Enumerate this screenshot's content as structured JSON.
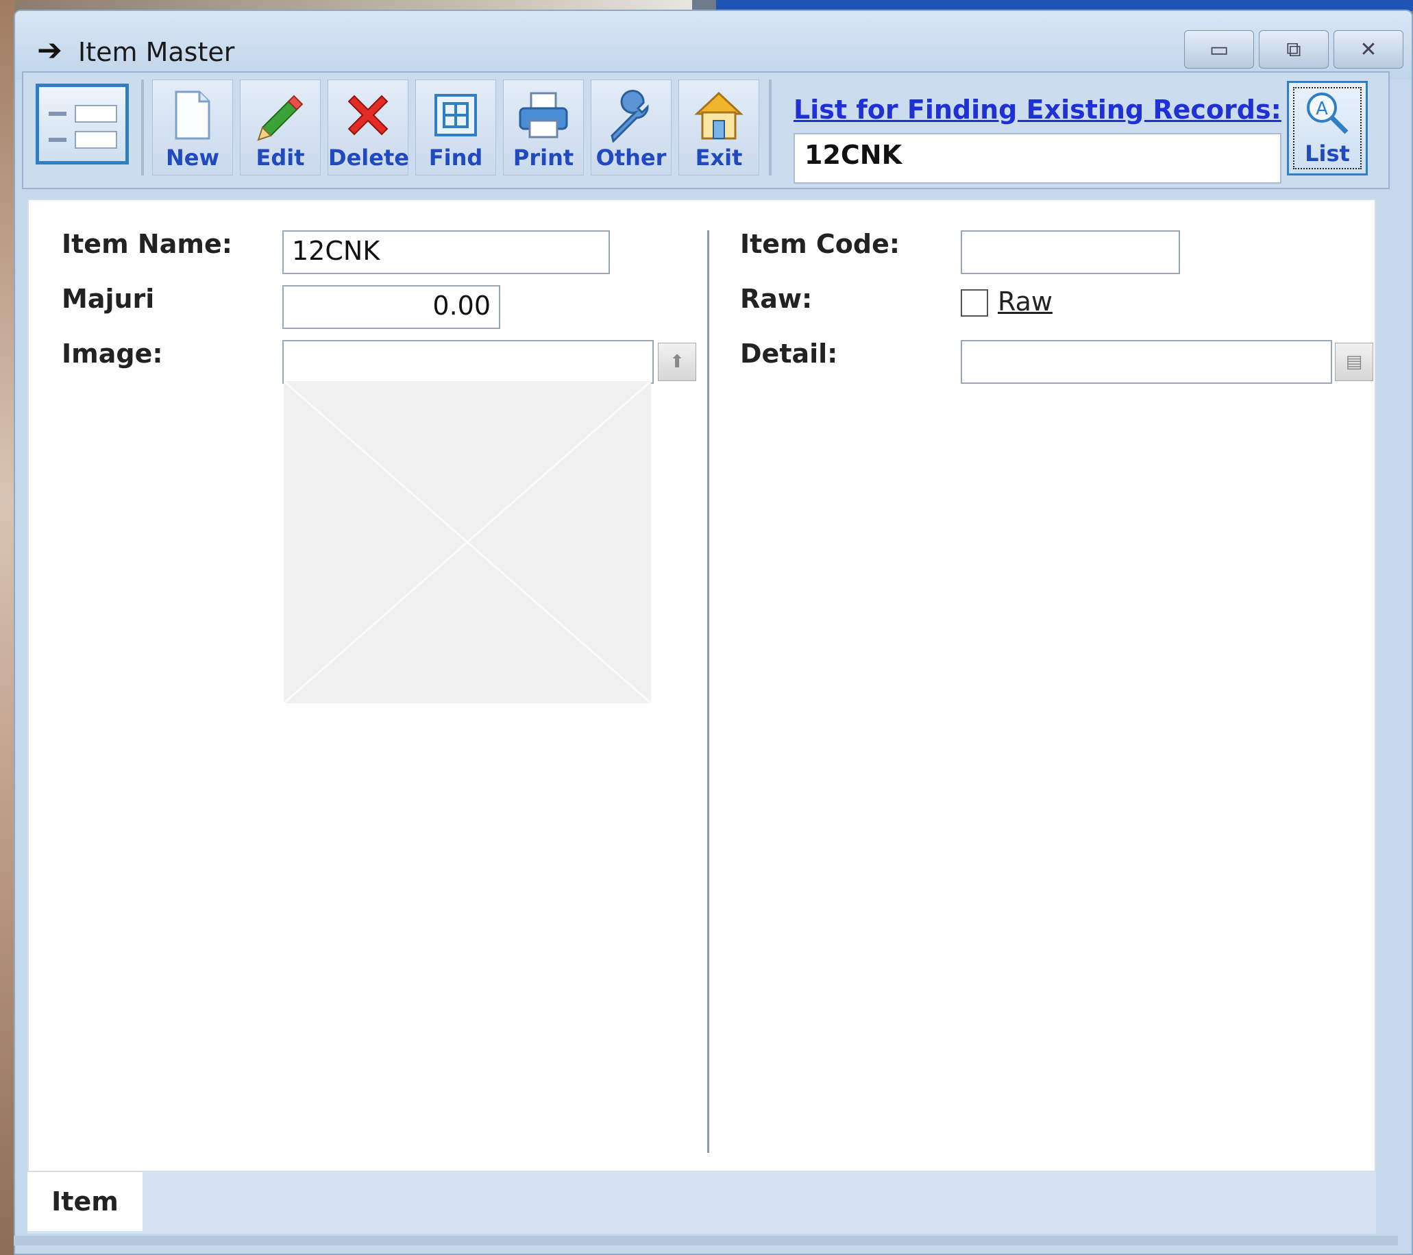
{
  "window": {
    "title": "Item Master",
    "controls": {
      "minimize": "▭",
      "restore": "⧉",
      "close": "✕"
    }
  },
  "toolbar": {
    "buttons": [
      {
        "label": "New",
        "icon": "new-document-icon"
      },
      {
        "label": "Edit",
        "icon": "pencil-icon"
      },
      {
        "label": "Delete",
        "icon": "delete-x-icon"
      },
      {
        "label": "Find",
        "icon": "find-grid-icon"
      },
      {
        "label": "Print",
        "icon": "printer-icon"
      },
      {
        "label": "Other",
        "icon": "wrench-icon"
      },
      {
        "label": "Exit",
        "icon": "house-exit-icon"
      }
    ],
    "finder": {
      "link_label": "List for Finding Existing Records:",
      "value": "12CNK",
      "list_button": "List"
    }
  },
  "form": {
    "item_name": {
      "label": "Item Name:",
      "value": "12CNK"
    },
    "majuri": {
      "label": "Majuri",
      "value": "0.00"
    },
    "image": {
      "label": "Image:",
      "value": ""
    },
    "item_code": {
      "label": "Item Code:",
      "value": ""
    },
    "raw": {
      "label": "Raw:",
      "checkbox_label": "Raw",
      "checked": false
    },
    "detail": {
      "label": "Detail:",
      "value": ""
    }
  },
  "tabs": [
    {
      "label": "Item",
      "active": true
    }
  ],
  "colors": {
    "accent": "#2149c0",
    "link": "#1f31d4",
    "frame": "#c5d8ec"
  }
}
